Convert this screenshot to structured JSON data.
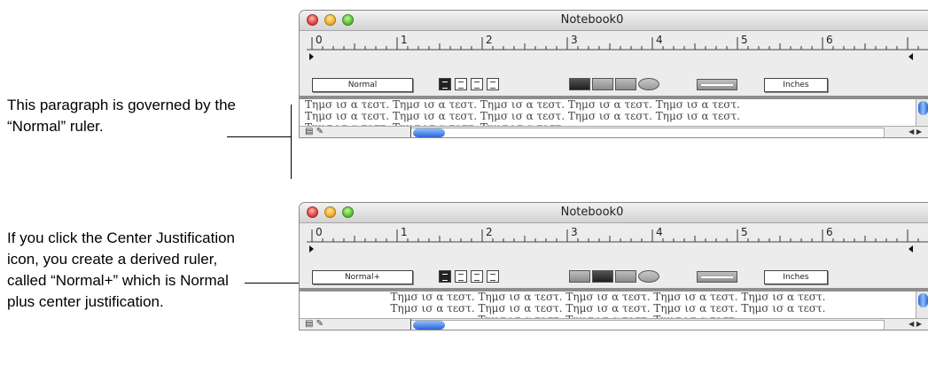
{
  "captions": {
    "first": "This paragraph is governed by the “Normal” ruler.",
    "second": "If you click the Center Justification icon, you create a derived ruler, called “Normal+” which is Normal plus center justification."
  },
  "windows": [
    {
      "title": "Notebook0",
      "ruler_numbers": [
        "0",
        "1",
        "2",
        "3",
        "4",
        "5",
        "6"
      ],
      "ruler_name": "Normal",
      "units": "Inches",
      "justification": "left",
      "active_justification_index": 0,
      "text_lines": [
        "Τημσ ισ α τεστ. Τημσ ισ α τεστ. Τημσ ισ α τεστ. Τημσ ισ α τεστ. Τημσ ισ α τεστ.",
        "Τημσ ισ α τεστ. Τημσ ισ α τεστ. Τημσ ισ α τεστ. Τημσ ισ α τεστ. Τημσ ισ α τεστ.",
        "Τημσ ισ α τεστ. Τημσ ισ α τεστ. Τημσ ισ α τεστ."
      ]
    },
    {
      "title": "Notebook0",
      "ruler_numbers": [
        "0",
        "1",
        "2",
        "3",
        "4",
        "5",
        "6"
      ],
      "ruler_name": "Normal+",
      "units": "Inches",
      "justification": "center",
      "active_justification_index": 0,
      "text_lines": [
        "Τημσ ισ α τεστ. Τημσ ισ α τεστ. Τημσ ισ α τεστ. Τημσ ισ α τεστ. Τημσ ισ α τεστ.",
        "Τημσ ισ α τεστ. Τημσ ισ α τεστ. Τημσ ισ α τεστ. Τημσ ισ α τεστ. Τημσ ισ α τεστ.",
        "Τημσ ισ α τεστ. Τημσ ισ α τεστ. Τημσ ισ α τεστ."
      ]
    }
  ],
  "icons": {
    "close": "close-icon",
    "minimize": "minimize-icon",
    "zoom": "zoom-icon",
    "justify": [
      "justify-left-icon",
      "justify-center-icon",
      "justify-right-icon",
      "justify-full-icon"
    ],
    "spacing": [
      "spacing-1-icon",
      "spacing-2-icon",
      "spacing-3-icon",
      "spacing-4-icon"
    ],
    "grid": "grid-toggle-icon",
    "status": "document-pencil-icon",
    "scroll_left": "arrow-left-icon",
    "scroll_right": "arrow-right-icon"
  },
  "status_glyphs": "▤ ✎",
  "scroll_arrow_glyphs": "◀ ▶"
}
